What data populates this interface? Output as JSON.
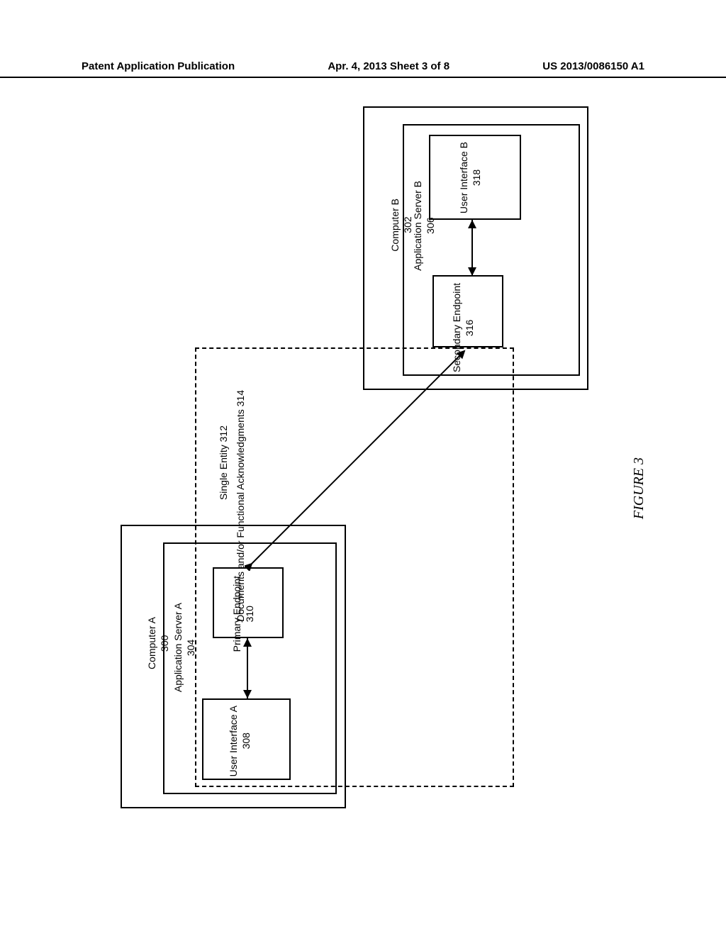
{
  "header": {
    "left": "Patent Application Publication",
    "center": "Apr. 4, 2013  Sheet 3 of 8",
    "right": "US 2013/0086150 A1"
  },
  "figure": {
    "caption": "FIGURE 3",
    "computer_a": {
      "label": "Computer A",
      "ref": "300"
    },
    "appserver_a": {
      "label": "Application Server A",
      "ref": "304"
    },
    "ui_a": {
      "label": "User Interface A",
      "ref": "308"
    },
    "primary_ep": {
      "label": "Primary Endpoint",
      "ref": "310"
    },
    "computer_b": {
      "label": "Computer B",
      "ref": "302"
    },
    "appserver_b": {
      "label": "Application Server B",
      "ref": "306"
    },
    "secondary_ep": {
      "label": "Secondary Endpoint",
      "ref": "316"
    },
    "ui_b": {
      "label": "User Interface B",
      "ref": "318"
    },
    "single_entity": {
      "label": "Single Entity",
      "ref": "312"
    },
    "docs": {
      "label": "Documents and/or Functional Acknowledgments",
      "ref": "314"
    }
  }
}
